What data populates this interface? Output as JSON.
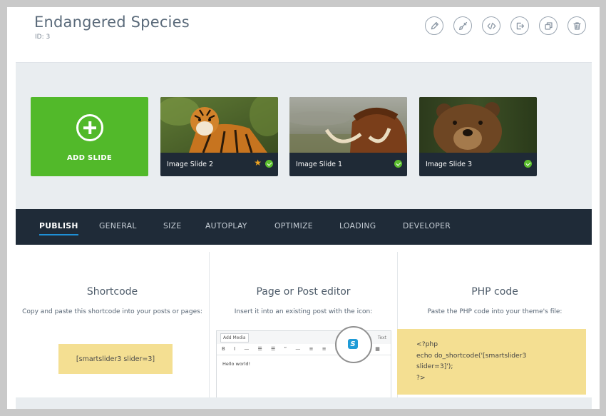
{
  "header": {
    "title": "Endangered Species",
    "id_label": "ID: 3"
  },
  "toolbar": {
    "edit": "pencil-icon",
    "design": "brush-icon",
    "code": "code-icon",
    "export": "export-icon",
    "duplicate": "duplicate-icon",
    "delete": "trash-icon"
  },
  "slides": {
    "add_label": "ADD SLIDE",
    "items": [
      {
        "label": "Image Slide 2",
        "starred": true,
        "published": true
      },
      {
        "label": "Image Slide 1",
        "starred": false,
        "published": true
      },
      {
        "label": "Image Slide 3",
        "starred": false,
        "published": true
      }
    ]
  },
  "tabs": [
    {
      "label": "PUBLISH",
      "active": true
    },
    {
      "label": "GENERAL",
      "active": false
    },
    {
      "label": "SIZE",
      "active": false
    },
    {
      "label": "AUTOPLAY",
      "active": false
    },
    {
      "label": "OPTIMIZE",
      "active": false
    },
    {
      "label": "LOADING",
      "active": false
    },
    {
      "label": "DEVELOPER",
      "active": false
    }
  ],
  "publish": {
    "shortcode": {
      "title": "Shortcode",
      "desc": "Copy and paste this shortcode into your posts or pages:",
      "code": "[smartslider3 slider=3]"
    },
    "editor": {
      "title": "Page or Post editor",
      "desc": "Insert it into an existing post with the icon:",
      "add_media": "Add Media",
      "text_tab": "Text",
      "toolbar": "B I — ☰ ☰ “ — ≡ ≡ ≡ ⧉ ⛓ ▦",
      "content": "Hello world!",
      "icon_letter": "S"
    },
    "php": {
      "title": "PHP code",
      "desc": "Paste the PHP code into your theme's file:",
      "code": "<?php\necho do_shortcode('[smartslider3\nslider=3]');\n?>"
    }
  },
  "colors": {
    "add_slide": "#52b92a",
    "nav_bg": "#1f2b38",
    "active_underline": "#1e90d6",
    "code_bg": "#f4df92",
    "check": "#5cbf2e",
    "star": "#f0a421"
  }
}
